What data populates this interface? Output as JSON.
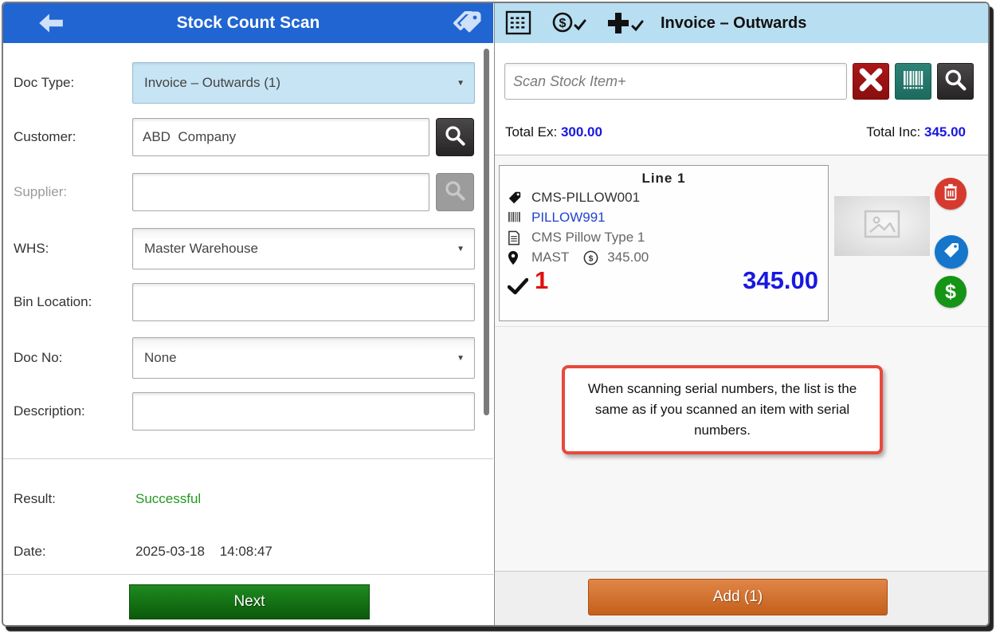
{
  "stock_panel": {
    "title": "Stock Count Scan",
    "fields": {
      "doc_type_label": "Doc Type:",
      "doc_type_value": "Invoice – Outwards (1)",
      "customer_label": "Customer:",
      "customer_value": "ABD  Company",
      "supplier_label": "Supplier:",
      "supplier_value": "",
      "whs_label": "WHS:",
      "whs_value": "Master Warehouse",
      "bin_label": "Bin Location:",
      "bin_value": "",
      "doc_no_label": "Doc No:",
      "doc_no_value": "None",
      "description_label": "Description:",
      "description_value": ""
    },
    "result_label": "Result:",
    "result_value": "Successful",
    "date_label": "Date:",
    "date_value": "2025-03-18",
    "time_value": "14:08:47",
    "next_button": "Next"
  },
  "invoice_panel": {
    "title": "Invoice – Outwards",
    "scan_placeholder": "Scan Stock Item+",
    "total_ex_label": "Total Ex:",
    "total_ex_value": "300.00",
    "total_inc_label": "Total Inc:",
    "total_inc_value": "345.00",
    "line": {
      "header": "Line 1",
      "item_code": "CMS-PILLOW001",
      "barcode": "PILLOW991",
      "description": "CMS Pillow Type 1",
      "warehouse": "MAST",
      "unit_price": "345.00",
      "quantity": "1",
      "line_total": "345.00"
    },
    "note": "When scanning serial numbers, the list is the same as if you scanned an item with serial numbers.",
    "add_button": "Add (1)"
  },
  "colors": {
    "header_blue": "#2065d1",
    "header_light_blue": "#b8def1",
    "value_blue": "#1818e0",
    "success_green": "#229922",
    "qty_red": "#e01010",
    "next_button_green": "#157515",
    "add_button_orange": "#cf6a26",
    "note_border_red": "#e8493c",
    "delete_red": "#d63a2f",
    "tag_blue": "#1576cc",
    "price_green": "#159415"
  }
}
